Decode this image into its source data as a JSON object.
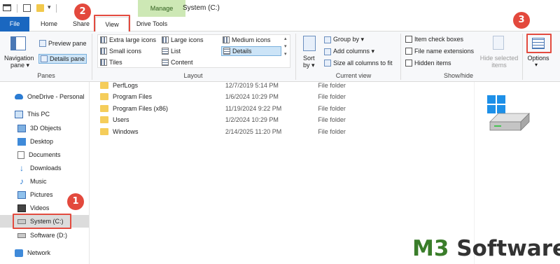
{
  "titlebar": {
    "manage_label": "Manage",
    "window_title": "System (C:)"
  },
  "tabs": {
    "file": "File",
    "home": "Home",
    "share": "Share",
    "view": "View",
    "drive_tools": "Drive Tools"
  },
  "ribbon": {
    "panes": {
      "navigation_pane": "Navigation",
      "navigation_pane_2": "pane ▾",
      "preview_pane": "Preview pane",
      "details_pane": "Details pane",
      "group_label": "Panes"
    },
    "layout": {
      "extra_large_icons": "Extra large icons",
      "large_icons": "Large icons",
      "medium_icons": "Medium icons",
      "small_icons": "Small icons",
      "list": "List",
      "details": "Details",
      "tiles": "Tiles",
      "content": "Content",
      "group_label": "Layout"
    },
    "current_view": {
      "sort_by_1": "Sort",
      "sort_by_2": "by ▾",
      "group_by": "Group by ▾",
      "add_columns": "Add columns ▾",
      "size_all_columns": "Size all columns to fit",
      "group_label": "Current view"
    },
    "show_hide": {
      "item_check_boxes": "Item check boxes",
      "file_name_extensions": "File name extensions",
      "hidden_items": "Hidden items",
      "hide_selected_1": "Hide selected",
      "hide_selected_2": "items",
      "group_label": "Show/hide"
    },
    "options": {
      "label": "Options",
      "arrow": "▾"
    }
  },
  "nav": {
    "items": [
      {
        "label": "OneDrive - Personal",
        "icon": "cloud-icon"
      },
      {
        "label": "This PC",
        "icon": "computer-icon"
      },
      {
        "label": "3D Objects",
        "icon": "cube-icon"
      },
      {
        "label": "Desktop",
        "icon": "desktop-icon"
      },
      {
        "label": "Documents",
        "icon": "document-icon"
      },
      {
        "label": "Downloads",
        "icon": "download-arrow-icon"
      },
      {
        "label": "Music",
        "icon": "music-note-icon"
      },
      {
        "label": "Pictures",
        "icon": "picture-icon"
      },
      {
        "label": "Videos",
        "icon": "video-icon"
      },
      {
        "label": "System (C:)",
        "icon": "drive-icon"
      },
      {
        "label": "Software (D:)",
        "icon": "drive-icon"
      },
      {
        "label": "Network",
        "icon": "network-icon"
      }
    ]
  },
  "files": [
    {
      "name": "PerfLogs",
      "date": "12/7/2019 5:14 PM",
      "type": "File folder"
    },
    {
      "name": "Program Files",
      "date": "1/6/2024 10:29 PM",
      "type": "File folder"
    },
    {
      "name": "Program Files (x86)",
      "date": "11/19/2024 9:22 PM",
      "type": "File folder"
    },
    {
      "name": "Users",
      "date": "1/2/2024 10:29 PM",
      "type": "File folder"
    },
    {
      "name": "Windows",
      "date": "2/14/2025 11:20 PM",
      "type": "File folder"
    }
  ],
  "badges": {
    "one": "1",
    "two": "2",
    "three": "3"
  },
  "watermark": {
    "m3": "M3",
    "software": " Software"
  },
  "colors": {
    "file_tab": "#1a67c0",
    "callout": "#e34b3f",
    "manage_tab": "#cde8b5",
    "folder": "#f5cd5a"
  }
}
